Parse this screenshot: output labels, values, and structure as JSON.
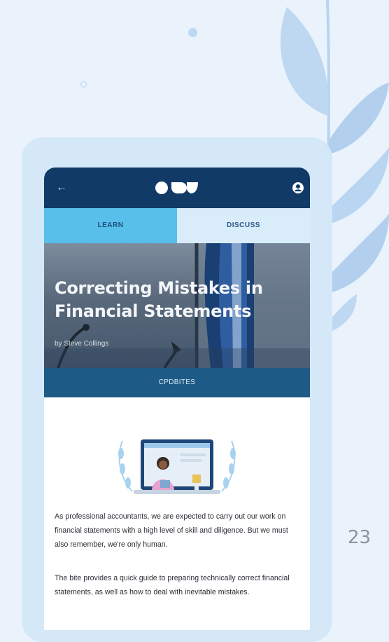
{
  "topbar": {
    "back_icon": "back-arrow-icon",
    "logo": "brand-logo",
    "profile_icon": "user-profile-icon"
  },
  "tabs": [
    {
      "label": "LEARN",
      "active": true
    },
    {
      "label": "DISCUSS",
      "active": false
    }
  ],
  "hero": {
    "title": "Correcting Mistakes in Financial Statements",
    "author": "by Steve Collings"
  },
  "category": "CPDBITES",
  "content": {
    "paragraphs": [
      "As professional accountants, we are expected to carry out our work on financial statements with a high level of skill and diligence. But we must also remember, we're only human.",
      "The bite provides a quick guide to preparing technically correct financial statements, as well as how to deal with inevitable mistakes."
    ]
  },
  "page_number": "23",
  "colors": {
    "background": "#eaf3fc",
    "frame": "#d4e8f8",
    "topbar": "#123a66",
    "tab_active": "#57bfe9",
    "tab_inactive": "#d9ecfa",
    "category_bar": "#1e5a86"
  }
}
